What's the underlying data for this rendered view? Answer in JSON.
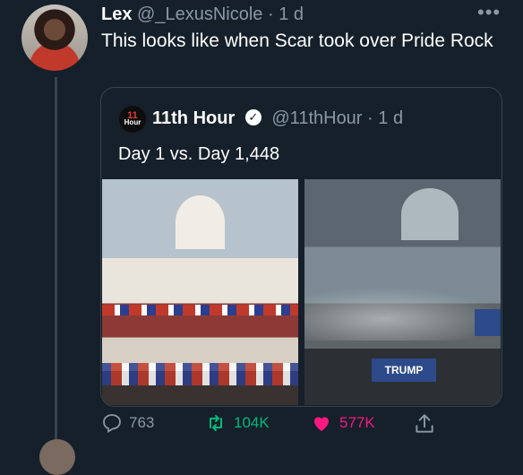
{
  "tweet": {
    "display_name": "Lex",
    "handle": "@_LexusNicole",
    "separator": "·",
    "time": "1 d",
    "more": "•••",
    "text": "This looks like when Scar took over Pride Rock"
  },
  "quoted": {
    "avatar_label_1": "11",
    "avatar_label_2": "Hour",
    "display_name": "11th Hour",
    "handle": "@11thHour",
    "separator": "·",
    "time": "1 d",
    "text": "Day 1 vs. Day 1,448",
    "image_right_banner": "TRUMP"
  },
  "actions": {
    "replies": "763",
    "retweets": "104K",
    "likes": "577K"
  },
  "colors": {
    "background": "#15202b",
    "muted": "#8b98a5",
    "border": "#38444d",
    "retweet": "#00ba7c",
    "like": "#f91880"
  },
  "icons": [
    "reply-icon",
    "retweet-icon",
    "heart-icon",
    "share-icon",
    "verified-icon",
    "more-icon"
  ]
}
